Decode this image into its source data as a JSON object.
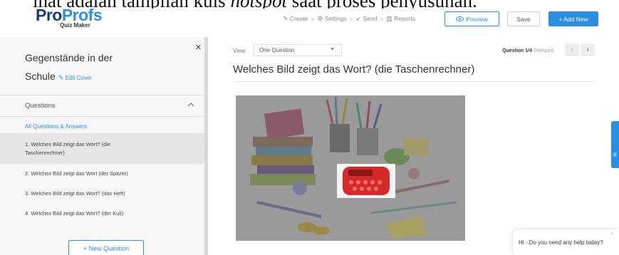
{
  "caption": {
    "before": "ihat adalah tampilan kuis ",
    "emphasis": "hotspot",
    "after": " saat proses penyusunan."
  },
  "header": {
    "logo_pro": "Pro",
    "logo_profs": "Profs",
    "logo_sub": "Quiz Maker",
    "nav": [
      {
        "icon": "pencil-icon",
        "glyph": "✎",
        "label": "Create"
      },
      {
        "icon": "gear-icon",
        "glyph": "⚙",
        "label": "Settings"
      },
      {
        "icon": "send-icon",
        "glyph": "➶",
        "label": "Send"
      },
      {
        "icon": "reports-icon",
        "glyph": "▥",
        "label": "Reports"
      }
    ],
    "nav_separator": ">",
    "preview_label": "Preview",
    "save_label": "Save",
    "add_new_label": "+ Add New"
  },
  "sidebar": {
    "cover_title_line1": "Gegenstände in der",
    "cover_title_line2": "Schule",
    "edit_cover_label": "Edit Cover",
    "close_glyph": "×",
    "questions_header": "Questions",
    "all_questions_link": "All Questions & Answers",
    "questions": [
      {
        "label": "1. Welches Bild zeigt das Wort? (die Taschenrechner)",
        "active": true
      },
      {
        "label": "2. Welches Bild zeigt das Wort (der Spitzer)",
        "active": false
      },
      {
        "label": "3. Welches Bild zeigt das Wort? (das Heft)",
        "active": false
      },
      {
        "label": "4. Welches Bild zeigt das Wort? (der Kuli)",
        "active": false
      }
    ],
    "new_question_label": "+ New Question"
  },
  "main": {
    "view_label": "View:",
    "view_value": "One Question",
    "counter_strong": "Question 1/4",
    "counter_type": "(Hotspot)",
    "question_title": "Welches Bild zeigt das Wort? (die Taschenrechner)"
  },
  "chat": {
    "message": "Hi - Do you need any help today?"
  },
  "colors": {
    "accent": "#2a8fe0",
    "logo_dark": "#1a3b73",
    "sidebar_bg": "#f7f7f7",
    "active_item_bg": "#e6e6e6"
  }
}
